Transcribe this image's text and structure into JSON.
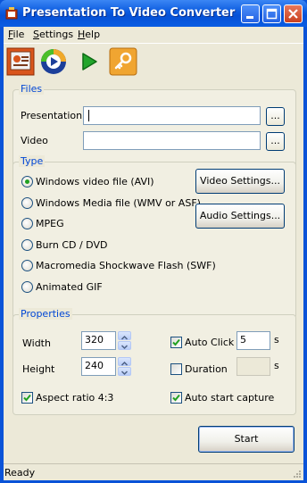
{
  "window": {
    "title": "Presentation To Video Converter"
  },
  "menu": [
    {
      "label": "File",
      "u": "F",
      "rest": "ile"
    },
    {
      "label": "Settings",
      "u": "S",
      "rest": "ettings"
    },
    {
      "label": "Help",
      "u": "H",
      "rest": "elp"
    }
  ],
  "toolbar": {
    "icons": [
      "powerpoint-icon",
      "media-player-icon",
      "play-icon",
      "key-icon"
    ]
  },
  "files": {
    "title": "Files",
    "presentation_label": "Presentation",
    "presentation_value": "",
    "video_label": "Video",
    "video_value": "",
    "browse_label": "..."
  },
  "type": {
    "title": "Type",
    "options": [
      "Windows video file (AVI)",
      "Windows Media file (WMV or ASF)",
      "MPEG",
      "Burn CD / DVD",
      "Macromedia Shockwave Flash (SWF)",
      "Animated GIF"
    ],
    "selected": "Windows video file (AVI)",
    "video_settings_label": "Video Settings...",
    "audio_settings_label": "Audio Settings..."
  },
  "properties": {
    "title": "Properties",
    "width_label": "Width",
    "width_value": "320",
    "height_label": "Height",
    "height_value": "240",
    "aspect_label": "Aspect ratio 4:3",
    "aspect_checked": true,
    "auto_click_label": "Auto Click",
    "auto_click_checked": true,
    "auto_click_value": "5",
    "auto_click_unit": "s",
    "duration_label": "Duration",
    "duration_checked": false,
    "duration_value": "",
    "duration_unit": "s",
    "auto_start_label": "Auto start capture",
    "auto_start_checked": true
  },
  "start_label": "Start",
  "status": "Ready",
  "colors": {
    "title_bar": "#0a5adf",
    "panel_title": "#0046d5",
    "radio_dot": "#21a121",
    "face": "#ece9d8"
  }
}
